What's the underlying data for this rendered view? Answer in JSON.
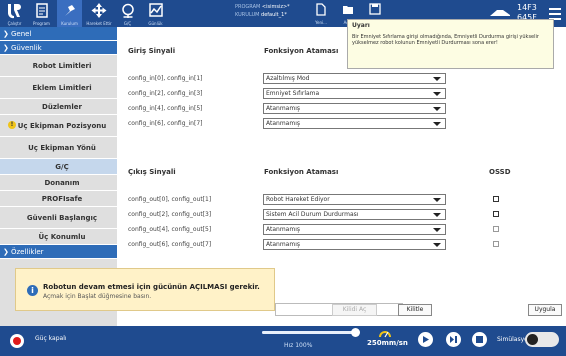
{
  "topbar": {
    "buttons": [
      {
        "label": "Çalıştır"
      },
      {
        "label": "Program"
      },
      {
        "label": "Kurulum"
      },
      {
        "label": "Hareket Ettir"
      },
      {
        "label": "G/Ç"
      },
      {
        "label": "Günlük"
      }
    ],
    "program_label": "PROGRAM",
    "program_value": "<isimsiz>*",
    "install_label": "KURULUM",
    "install_value": "default_1*",
    "file_buttons": [
      {
        "label": "Yeni..."
      },
      {
        "label": "Aç..."
      },
      {
        "label": "Kaydet"
      }
    ],
    "robot_id_line1": "14F3",
    "robot_id_line2": "645F"
  },
  "sidebar": {
    "genel": "Genel",
    "guvenlik": "Güvenlik",
    "items": [
      {
        "label": "Robot Limitleri"
      },
      {
        "label": "Eklem Limitleri"
      },
      {
        "label": "Düzlemler"
      },
      {
        "label": "Uç Ekipman Pozisyonu"
      },
      {
        "label": "Uç Ekipman Yönü"
      },
      {
        "label": "G/Ç"
      },
      {
        "label": "Donanım"
      },
      {
        "label": "PROFIsafe"
      },
      {
        "label": "Güvenli Başlangıç"
      },
      {
        "label": "Üç Konumlu"
      }
    ],
    "ozellikler": "Özellikler"
  },
  "inputs": {
    "col1": "Giriş Sinyali",
    "col2": "Fonksiyon Ataması",
    "rows": [
      {
        "signal": "config_in[0], config_in[1]",
        "function": "Azaltılmış Mod"
      },
      {
        "signal": "config_in[2], config_in[3]",
        "function": "Emniyet Sıfırlama"
      },
      {
        "signal": "config_in[4], config_in[5]",
        "function": "Atanmamış"
      },
      {
        "signal": "config_in[6], config_in[7]",
        "function": "Atanmamış"
      }
    ]
  },
  "outputs": {
    "col1": "Çıkış Sinyali",
    "col2": "Fonksiyon Ataması",
    "col3": "OSSD",
    "rows": [
      {
        "signal": "config_out[0], config_out[1]",
        "function": "Robot Hareket Ediyor"
      },
      {
        "signal": "config_out[2], config_out[3]",
        "function": "Sistem Acil Durum Durdurması"
      },
      {
        "signal": "config_out[4], config_out[5]",
        "function": "Atanmamış"
      },
      {
        "signal": "config_out[6], config_out[7]",
        "function": "Atanmamış"
      }
    ]
  },
  "tooltip": {
    "title": "Uyarı",
    "body": "Bir Emniyet Sıfırlama girişi olmadığında, Emniyetli Durdurma girişi yükselir yükselmez robot kolunun Emniyetli Durdurması sona erer!"
  },
  "toast": {
    "title": "Robotun devam etmesi için gücünün AÇILMASI gerekir.",
    "subtitle": "Açmak için Başlat düğmesine basın."
  },
  "actions": {
    "unlock": "Kilidi Aç",
    "lock": "Kilitle",
    "apply": "Uygula"
  },
  "bottombar": {
    "power_status": "Güç kapalı",
    "speed_percent": 100,
    "speed_label": "Hız 100%",
    "tcp_speed": "250mm/sn",
    "simulation": "Simülasyon"
  },
  "colors": {
    "header_blue": "#1f4b8f",
    "accent_blue": "#2e6cb8",
    "power_red": "#e01b1b",
    "warning_yellow": "#f0c419"
  }
}
